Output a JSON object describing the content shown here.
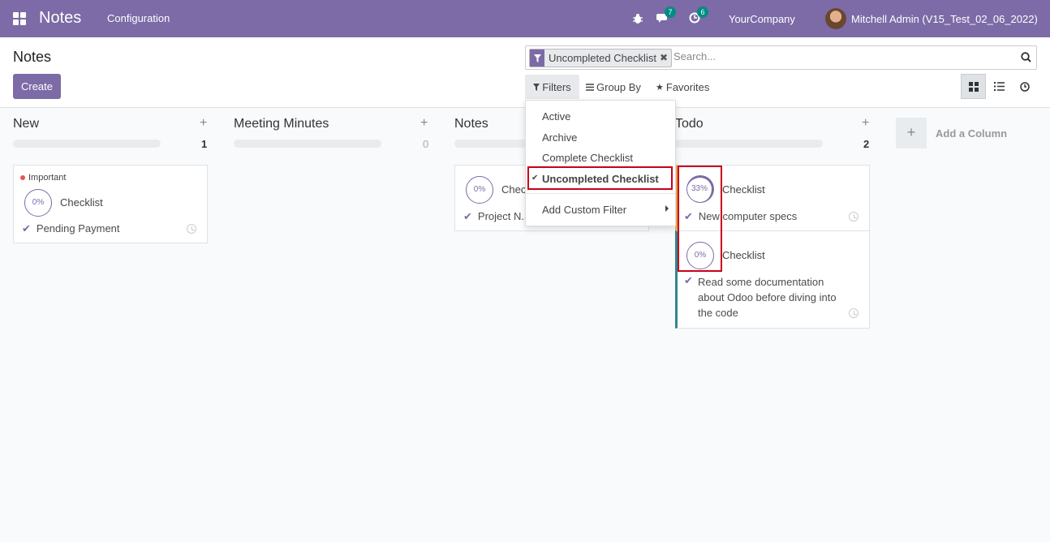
{
  "navbar": {
    "app_name": "Notes",
    "menu_configuration": "Configuration",
    "messages_count": "7",
    "activities_count": "6",
    "company": "YourCompany",
    "user": "Mitchell Admin (V15_Test_02_06_2022)"
  },
  "control": {
    "title": "Notes",
    "create_label": "Create",
    "facet_label": "Uncompleted Checklist",
    "search_placeholder": "Search...",
    "filters_label": "Filters",
    "groupby_label": "Group By",
    "favorites_label": "Favorites"
  },
  "filter_menu": {
    "items": [
      "Active",
      "Archive",
      "Complete Checklist",
      "Uncompleted Checklist"
    ],
    "selected": "Uncompleted Checklist",
    "custom_filter": "Add Custom Filter"
  },
  "columns": [
    {
      "name": "New",
      "count": "1",
      "cards": [
        {
          "tag": "Important",
          "progress": "0%",
          "title": "Checklist",
          "items": [
            "Pending Payment"
          ]
        }
      ]
    },
    {
      "name": "Meeting Minutes",
      "count": "0",
      "cards": []
    },
    {
      "name": "Notes",
      "count": "",
      "cards": [
        {
          "progress": "0%",
          "title": "Checklist",
          "items": [
            "Project N.S"
          ]
        }
      ]
    },
    {
      "name": "Todo",
      "count": "2",
      "cards": [
        {
          "progress": "33%",
          "title": "Checklist",
          "items": [
            "New computer specs"
          ]
        },
        {
          "progress": "0%",
          "title": "Checklist",
          "items": [
            "Read some documentation about Odoo before diving into the code"
          ]
        }
      ]
    }
  ],
  "add_column_label": "Add a Column",
  "colors": {
    "brand": "#7c6ba6",
    "badge": "#018c83",
    "highlight": "#c9001a",
    "todo_accent_yellow": "#f0ad4e",
    "todo_accent_teal": "#2f8792"
  }
}
